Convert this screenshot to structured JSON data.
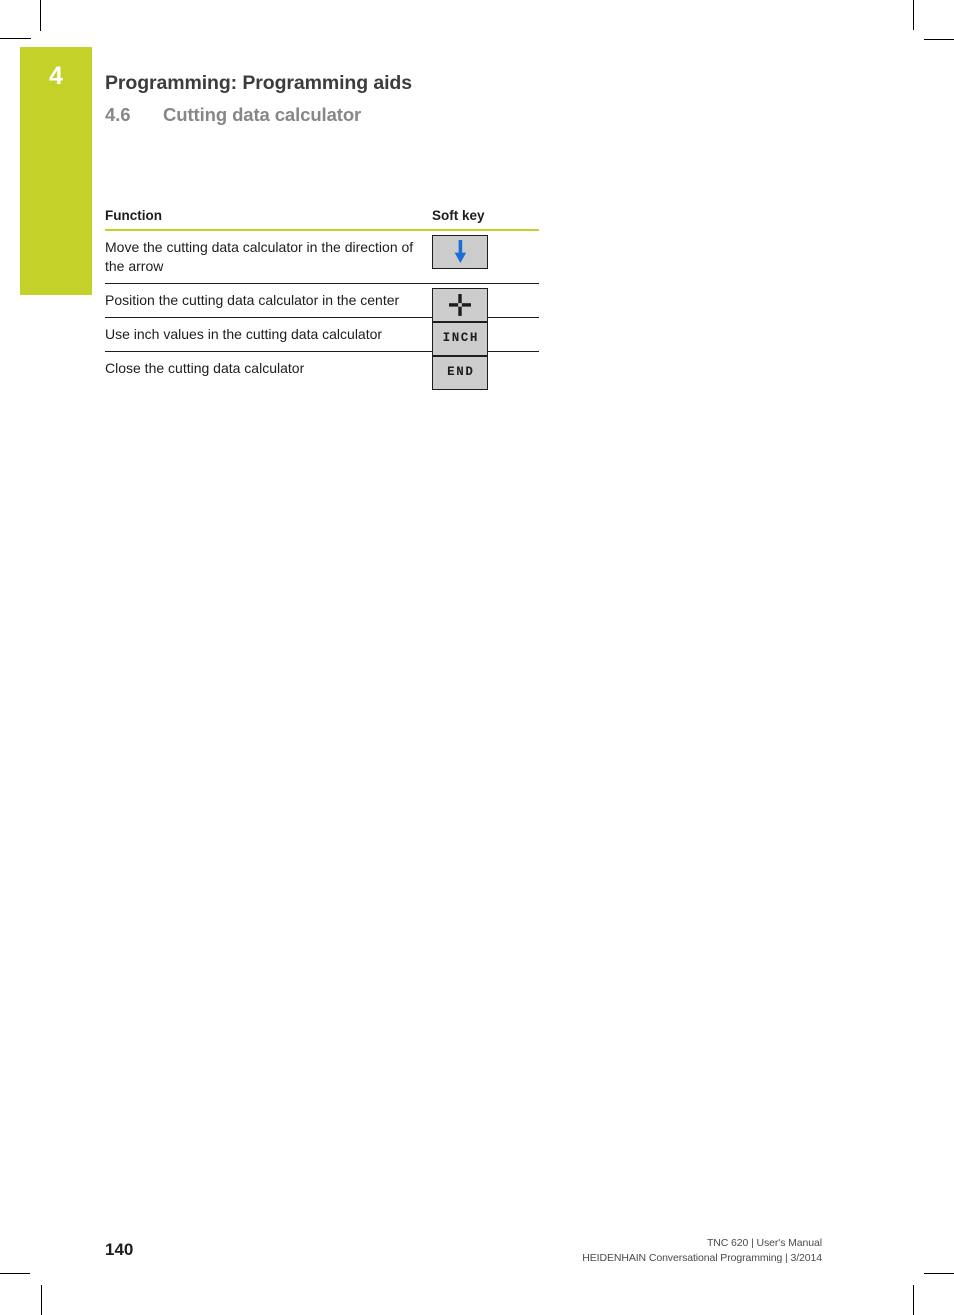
{
  "page": {
    "chapter_number": "4",
    "chapter_title": "Programming: Programming aids",
    "section_number": "4.6",
    "section_title": "Cutting data calculator",
    "page_number": "140",
    "accent_color": "#c4d128",
    "softkey_face_color": "#cccccc",
    "arrow_color": "#1b6fd4"
  },
  "table": {
    "headers": {
      "function": "Function",
      "soft_key": "Soft key"
    },
    "rows": [
      {
        "function": "Move the cutting data calculator in the direction of the arrow",
        "softkey_type": "icon",
        "softkey_icon": "arrow-down-icon",
        "softkey_label": ""
      },
      {
        "function": "Position the cutting data calculator in the center",
        "softkey_type": "icon",
        "softkey_icon": "crosshair-center-icon",
        "softkey_label": ""
      },
      {
        "function": "Use inch values in the cutting data calculator",
        "softkey_type": "text",
        "softkey_icon": "inch-softkey",
        "softkey_label": "INCH"
      },
      {
        "function": "Close the cutting data calculator",
        "softkey_type": "text",
        "softkey_icon": "end-softkey",
        "softkey_label": "END"
      }
    ]
  },
  "footer": {
    "line1": "TNC 620 | User's Manual",
    "line2": "HEIDENHAIN Conversational Programming | 3/2014"
  }
}
